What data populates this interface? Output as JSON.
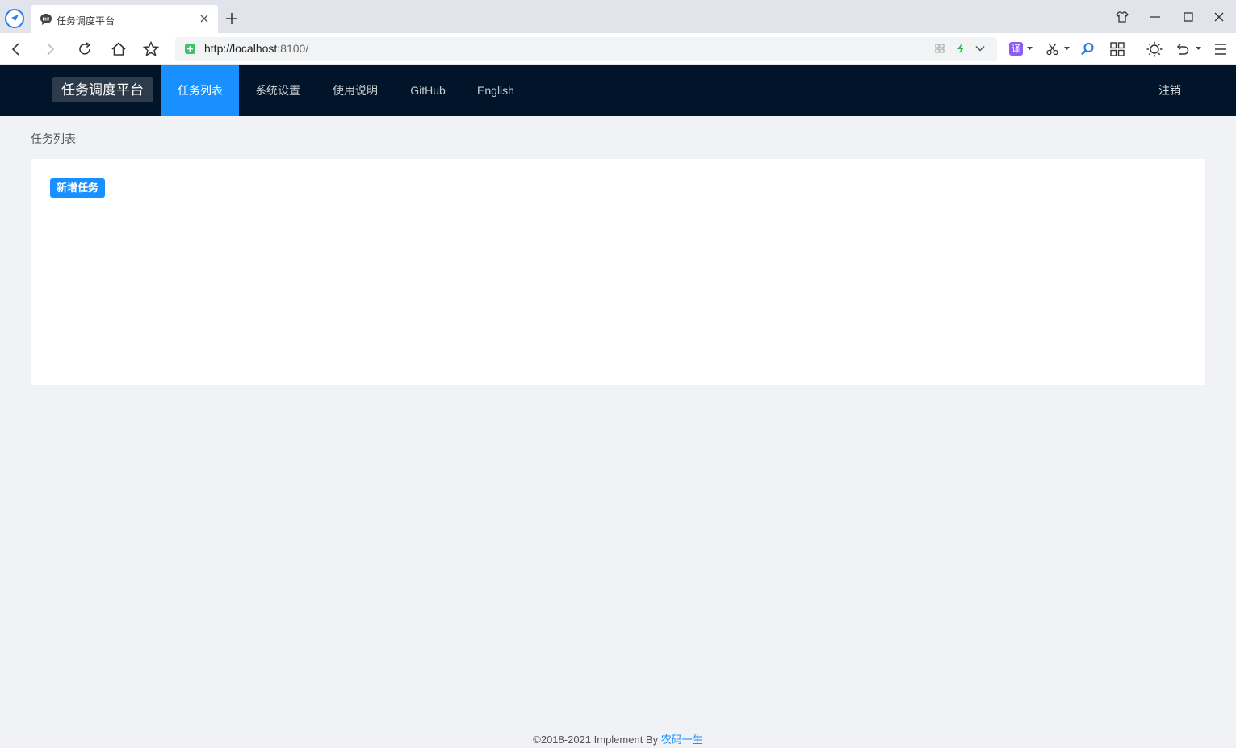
{
  "browser": {
    "tab_title": "任务调度平台",
    "url_host": "http://localhost",
    "url_rest": ":8100/",
    "translate_label": "译"
  },
  "header": {
    "brand": "任务调度平台",
    "nav": [
      {
        "label": "任务列表",
        "active": true
      },
      {
        "label": "系统设置",
        "active": false
      },
      {
        "label": "使用说明",
        "active": false
      },
      {
        "label": "GitHub",
        "active": false
      },
      {
        "label": "English",
        "active": false
      }
    ],
    "logout": "注销"
  },
  "page": {
    "breadcrumb": "任务列表",
    "add_task_button": "新增任务"
  },
  "footer": {
    "copyright": "©2018-2021 Implement By ",
    "author": "农码一生"
  },
  "colors": {
    "header_bg": "#001529",
    "accent": "#1890ff",
    "page_bg": "#f0f2f5"
  }
}
